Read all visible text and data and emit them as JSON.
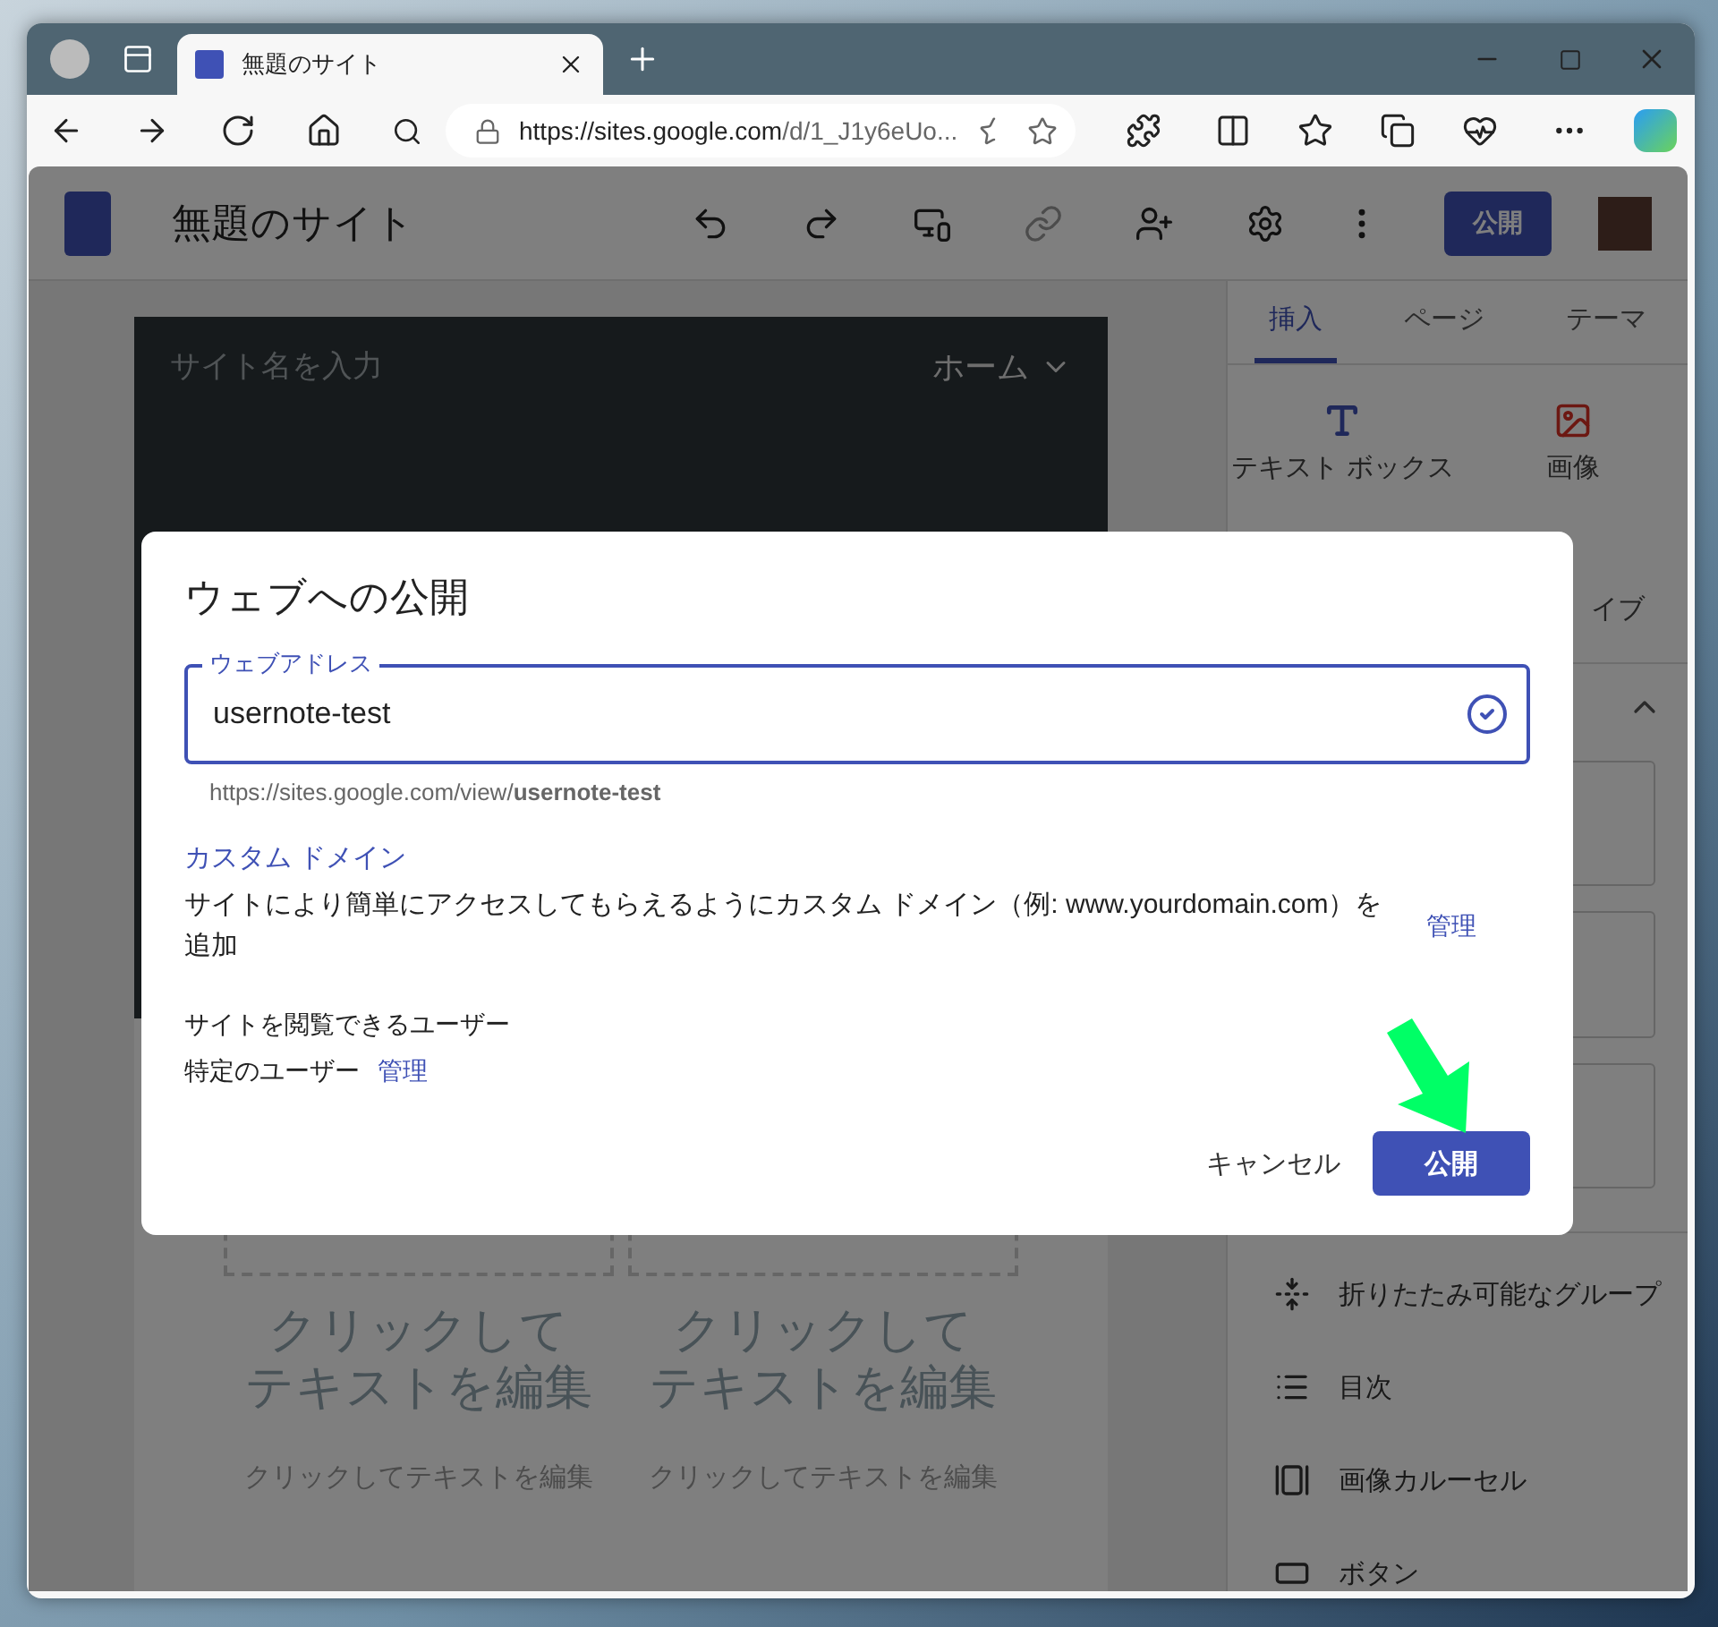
{
  "browser": {
    "tab_title": "無題のサイト",
    "url_host": "https://sites.google.com",
    "url_path": "/d/1_J1y6eUo..."
  },
  "app": {
    "site_title": "無題のサイト",
    "publish_button": "公開"
  },
  "canvas": {
    "site_name_placeholder": "サイト名を入力",
    "nav_item": "ホーム",
    "columns": [
      {
        "heading": "クリックしてテキストを編集",
        "body": "クリックしてテキストを編集"
      },
      {
        "heading": "クリックしてテキストを編集",
        "body": "クリックしてテキストを編集"
      }
    ]
  },
  "sidebar": {
    "tabs": [
      {
        "label": "挿入",
        "selected": true
      },
      {
        "label": "ページ",
        "selected": false
      },
      {
        "label": "テーマ",
        "selected": false
      }
    ],
    "insert_items": [
      {
        "kind": "text",
        "label": "テキスト ボックス"
      },
      {
        "kind": "image",
        "label": "画像"
      }
    ],
    "partial_label": "イブ",
    "components": [
      {
        "kind": "collapse",
        "label": "折りたたみ可能なグループ"
      },
      {
        "kind": "toc",
        "label": "目次"
      },
      {
        "kind": "carousel",
        "label": "画像カルーセル"
      },
      {
        "kind": "button",
        "label": "ボタン"
      }
    ]
  },
  "dialog": {
    "title": "ウェブへの公開",
    "field": {
      "label": "ウェブアドレス",
      "value": "usernote-test",
      "valid": true
    },
    "url_hint": "https://sites.google.com/view/**usernote-test**",
    "custom_domain": {
      "heading": "カスタム ドメイン",
      "description": "サイトにより簡単にアクセスしてもらえるようにカスタム ドメイン（例: www.yourdomain.com）を追加",
      "link": "管理"
    },
    "viewers": {
      "heading": "サイトを閲覧できるユーザー",
      "value": "特定のユーザー",
      "link": "管理"
    },
    "buttons": [
      {
        "kind": "text",
        "label": "キャンセル"
      },
      {
        "kind": "primary",
        "label": "公開"
      }
    ]
  }
}
